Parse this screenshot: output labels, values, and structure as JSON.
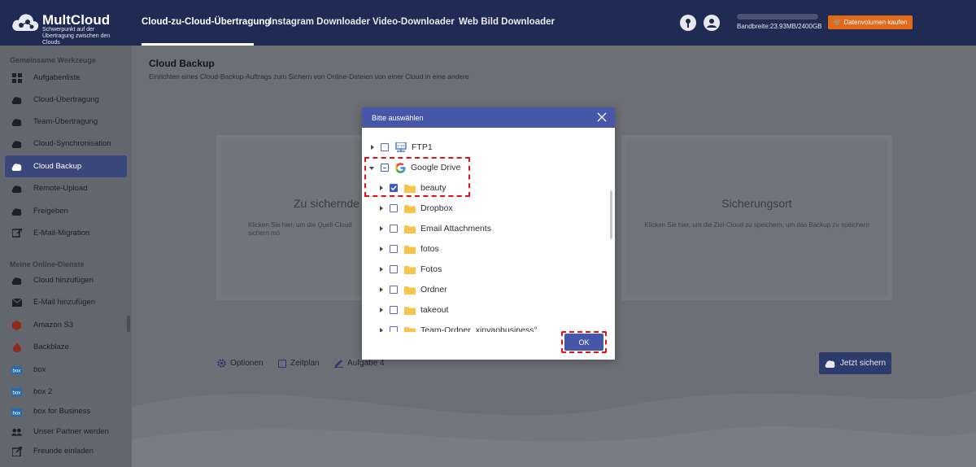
{
  "app": {
    "logo_title": "MultCloud",
    "logo_subtitle": "Schwerpunkt auf der Übertragung zwischen den Clouds"
  },
  "nav": {
    "items": [
      {
        "label": "Cloud-zu-Cloud-Übertragung",
        "active": true
      },
      {
        "label": "Instagram Downloader",
        "active": false
      },
      {
        "label": "Video-Downloader",
        "active": false
      },
      {
        "label": "Web Bild Downloader",
        "active": false
      }
    ],
    "bandwidth_text": "Bandbreite:23.93MB/2400GB",
    "bandwidth_used_fraction": 0.01,
    "buy_button": "Datenvolumen kaufen"
  },
  "sidebar": {
    "section1_title": "Gemeinsame Werkzeuge",
    "tools": [
      {
        "label": "Aufgabenliste",
        "icon": "grid-icon",
        "active": false
      },
      {
        "label": "Cloud-Übertragung",
        "icon": "cloud-transfer-icon",
        "active": false
      },
      {
        "label": "Team-Übertragung",
        "icon": "team-transfer-icon",
        "active": false
      },
      {
        "label": "Cloud-Synchronisation",
        "icon": "cloud-sync-icon",
        "active": false
      },
      {
        "label": "Cloud Backup",
        "icon": "cloud-backup-icon",
        "active": true
      },
      {
        "label": "Remote-Upload",
        "icon": "remote-upload-icon",
        "active": false
      },
      {
        "label": "Freigeben",
        "icon": "share-icon",
        "active": false
      },
      {
        "label": "E-Mail-Migration",
        "icon": "email-migration-icon",
        "active": false
      }
    ],
    "section2_title": "Meine Online-Dienste",
    "services": [
      {
        "label": "Cloud hinzufügen",
        "icon": "cloud-add-icon"
      },
      {
        "label": "E-Mail hinzufügen",
        "icon": "email-add-icon"
      },
      {
        "label": "Amazon S3",
        "icon": "amazon-s3-icon"
      },
      {
        "label": "Backblaze",
        "icon": "backblaze-icon"
      },
      {
        "label": "box",
        "icon": "box-icon"
      },
      {
        "label": "box 2",
        "icon": "box-icon"
      },
      {
        "label": "box for Business",
        "icon": "box-icon"
      }
    ],
    "footer": [
      {
        "label": "Unser Partner werden",
        "icon": "partner-icon"
      },
      {
        "label": "Freunde einladen",
        "icon": "invite-icon"
      }
    ]
  },
  "main": {
    "title": "Cloud Backup",
    "subtitle": "Einrichten eines Cloud-Backup-Auftrags zum Sichern von Online-Dateien von einer Cloud in eine andere",
    "source_card": {
      "title": "Zu sichernde",
      "desc": "Klicken Sie hier, um die Quell-Cloud\nsichern mö"
    },
    "target_card": {
      "title": "Sicherungsort",
      "desc": "Klicken Sie hier, um die Ziel-Cloud zu speichern, um das Backup zu speichern"
    },
    "options_label": "Optionen",
    "schedule_label": "Zeitplan",
    "task_label": "Aufgabe 4",
    "save_button": "Jetzt sichern"
  },
  "modal": {
    "title": "Bitte auswählen",
    "ok_button": "OK",
    "items": [
      {
        "label": "FTP1",
        "level": 0,
        "expanded": false,
        "state": "unchecked",
        "icon": "ftp-icon"
      },
      {
        "label": "Google Drive",
        "level": 0,
        "expanded": true,
        "state": "partial",
        "icon": "google-drive-icon"
      },
      {
        "label": "beauty",
        "level": 1,
        "expanded": false,
        "state": "checked",
        "icon": "folder-icon"
      },
      {
        "label": "Dropbox",
        "level": 1,
        "expanded": false,
        "state": "unchecked",
        "icon": "folder-icon"
      },
      {
        "label": "Email Attachments",
        "level": 1,
        "expanded": false,
        "state": "unchecked",
        "icon": "folder-icon"
      },
      {
        "label": "fotos",
        "level": 1,
        "expanded": false,
        "state": "unchecked",
        "icon": "folder-icon"
      },
      {
        "label": "Fotos",
        "level": 1,
        "expanded": false,
        "state": "unchecked",
        "icon": "folder-icon"
      },
      {
        "label": "Ordner",
        "level": 1,
        "expanded": false,
        "state": "unchecked",
        "icon": "folder-icon"
      },
      {
        "label": "takeout",
        "level": 1,
        "expanded": false,
        "state": "unchecked",
        "icon": "folder-icon"
      },
      {
        "label": "Team-Ordner_xinyaobusiness°",
        "level": 1,
        "expanded": false,
        "state": "unchecked",
        "icon": "folder-icon"
      }
    ]
  },
  "colors": {
    "topbar": "#1f2b52",
    "accent": "#4656a8",
    "orange": "#e06a1a",
    "highlight_dash": "#e3101a",
    "folder": "#f7c54a"
  }
}
